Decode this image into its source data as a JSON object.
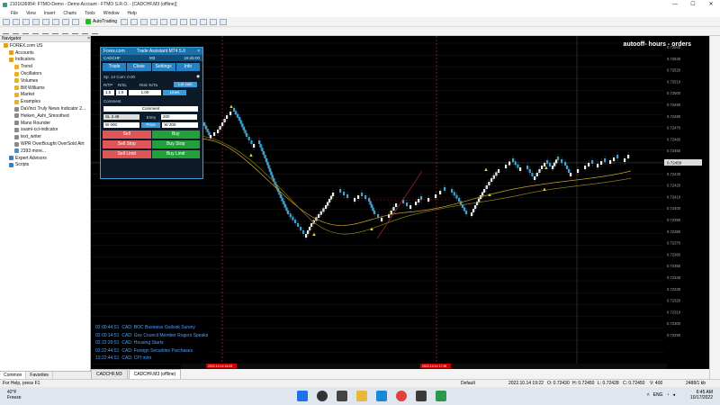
{
  "window": {
    "title": "2101636954: FTMO-Demo - Demo Account - FTMO S.R.O. - [CADCHF,M3 (offline)]",
    "controls": [
      "—",
      "☐",
      "✕"
    ]
  },
  "menu": [
    "File",
    "View",
    "Insert",
    "Charts",
    "Tools",
    "Window",
    "Help"
  ],
  "toolbar": {
    "autotrading_label": "AutoTrading"
  },
  "navigator": {
    "title": "Navigator",
    "close": "×",
    "items": [
      {
        "label": "FOREX.com US",
        "indent": 1,
        "color": "#e0a020"
      },
      {
        "label": "Accounts",
        "indent": 2,
        "color": "#e0a020"
      },
      {
        "label": "Indicators",
        "indent": 2,
        "color": "#e0a020"
      },
      {
        "label": "Trend",
        "indent": 3,
        "color": "#e8b030"
      },
      {
        "label": "Oscillators",
        "indent": 3,
        "color": "#e8b030"
      },
      {
        "label": "Volumes",
        "indent": 3,
        "color": "#e8b030"
      },
      {
        "label": "Bill Williams",
        "indent": 3,
        "color": "#e8b030"
      },
      {
        "label": "Market",
        "indent": 3,
        "color": "#e8b030"
      },
      {
        "label": "Examples",
        "indent": 3,
        "color": "#e8b030"
      },
      {
        "label": "DaVinci Truly News Indicator 2...",
        "indent": 3,
        "color": "#8a8a8a"
      },
      {
        "label": "Heiken_Ashi_Smoothed",
        "indent": 3,
        "color": "#8a8a8a"
      },
      {
        "label": "Mano Rounder",
        "indent": 3,
        "color": "#8a8a8a"
      },
      {
        "label": "ssami-cci-indicator",
        "indent": 3,
        "color": "#8a8a8a"
      },
      {
        "label": "text_writer",
        "indent": 3,
        "color": "#8a8a8a"
      },
      {
        "label": "WPR OverBought OverSold Alrt",
        "indent": 3,
        "color": "#8a8a8a"
      },
      {
        "label": "2393 more...",
        "indent": 3,
        "color": "#4a90d0"
      },
      {
        "label": "Expert Advisors",
        "indent": 2,
        "color": "#3a80c0"
      },
      {
        "label": "Scripts",
        "indent": 2,
        "color": "#3a80c0"
      }
    ],
    "tabs": [
      "Common",
      "Favorites"
    ]
  },
  "chart": {
    "overlay_title": "autooff- hours - orders",
    "tabs": [
      "CADCHF,M3",
      "CADCHF,M3 (offline)"
    ],
    "price_labels": [
      "0.72540",
      "0.72530",
      "0.72520",
      "0.72510",
      "0.72500",
      "0.72490",
      "0.72480",
      "0.72470",
      "0.72460",
      "0.72450",
      "0.72440",
      "0.72430",
      "0.72420",
      "0.72410",
      "0.72400",
      "0.72390",
      "0.72380",
      "0.72370",
      "0.72360",
      "0.72350",
      "0.72340",
      "0.72330",
      "0.72320",
      "0.72310",
      "0.72300",
      "0.72290"
    ],
    "current_price": "0.72450",
    "red_time_labels": [
      "2022.10.14 14:03",
      "2022.10.14 17:39"
    ]
  },
  "trade_panel": {
    "brand": "Forex.com",
    "title": "Trade Assistant MT4 5.0",
    "symbol": "CADCHF",
    "timeframe": "M3",
    "time": "16:45:00",
    "tabs": [
      "Trade",
      "Close",
      "Settings",
      "Info"
    ],
    "spread": "Sp: 14  Com: 0.00",
    "labels": {
      "tp": "R/TP",
      "sl": "R/SL",
      "risk": "Risk %/Ta",
      "lots_label": "Lot calc"
    },
    "tp_val": "1.5",
    "sl_val": "1.0",
    "risk_val": "1.00",
    "lots_btn": "Lines",
    "comment_label": "Comment",
    "comment_val": "Comment",
    "sl_row": {
      "label": "SL",
      "val": "2.49",
      "entry_label": "Entry",
      "entry_val": "200"
    },
    "row_w": {
      "left": "W",
      "left_val": "000",
      "mid": "Price",
      "right": "W",
      "right_val": "200"
    },
    "buttons": {
      "sell": "Sell",
      "buy": "Buy",
      "sell_stop": "Sell Stop",
      "buy_stop": "Buy Stop",
      "sell_limit": "Sell Limit",
      "buy_limit": "Buy Limit"
    }
  },
  "news": [
    {
      "time": "02:00:44:51",
      "text": "CAD: BOC Business Outlook Survey"
    },
    {
      "time": "02:00:14:51",
      "text": "CAD: Gov Council Member Rogers Speaks"
    },
    {
      "time": "02:22:29:51",
      "text": "CAD: Housing Starts"
    },
    {
      "time": "02:22:44:51",
      "text": "CAD: Foreign Securities Purchases"
    },
    {
      "time": "13:22:44:51",
      "text": "CAD: CPI m/m"
    }
  ],
  "status": {
    "help": "For Help, press F1",
    "profile": "Default",
    "datetime": "2022.10.14 19:22",
    "o": "O: 0.72430",
    "h": "H: 0.72450",
    "l": "L: 0.72428",
    "c": "C: 0.72450",
    "v": "V: 400",
    "kb": "2488/1 kb"
  },
  "taskbar": {
    "temp": "42°F",
    "weather": "Freeze",
    "time": "6:45 AM",
    "date": "10/17/2022",
    "lang": "ENG"
  }
}
